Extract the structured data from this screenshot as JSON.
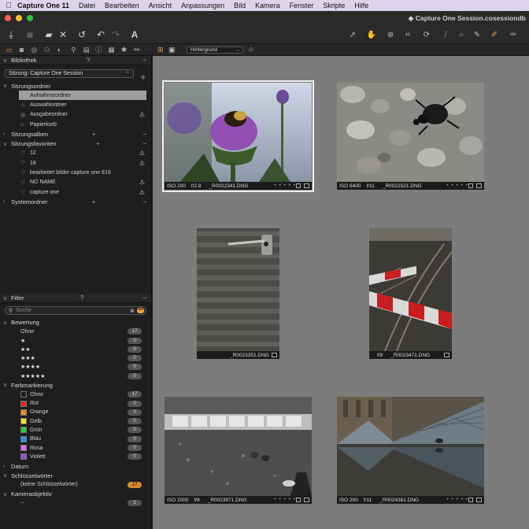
{
  "menubar": {
    "apple": "",
    "app": "Capture One 11",
    "items": [
      "Datei",
      "Bearbeiten",
      "Ansicht",
      "Anpassungen",
      "Bild",
      "Kamera",
      "Fenster",
      "Skripte",
      "Hilfe"
    ]
  },
  "window": {
    "title": "Capture One Session.cosessiondb"
  },
  "colors": {
    "accent": "#e9a23b",
    "close": "#ff5f57",
    "min": "#febc2e",
    "max": "#28c840"
  },
  "library": {
    "title": "Bibliothek",
    "help": "?",
    "menu": "–",
    "session_select": "Sitzung: Capture One Session",
    "folders_header": "Sitzungsordner",
    "folders": [
      {
        "label": "Aufnahmeordner",
        "icon": "◎",
        "selected": true,
        "warn": ""
      },
      {
        "label": "Auswahlordner",
        "icon": "☆",
        "selected": false,
        "warn": ""
      },
      {
        "label": "Ausgabeordner",
        "icon": "◎",
        "selected": false,
        "warn": "⚠"
      },
      {
        "label": "Papierkorb",
        "icon": "⌂",
        "selected": false,
        "warn": ""
      }
    ],
    "albums_header": "Sitzungsalben",
    "favorites_header": "Sitzungsfavoriten",
    "favorites": [
      {
        "label": "12",
        "warn": "⚠"
      },
      {
        "label": "18",
        "warn": "⚠"
      },
      {
        "label": "bearbeitet bilder capture one 819",
        "warn": ""
      },
      {
        "label": "NO NAME",
        "warn": "⚠"
      },
      {
        "label": "capture one",
        "warn": "⚠"
      }
    ],
    "system_header": "Systemordner"
  },
  "filter": {
    "title": "Filter",
    "help": "?",
    "menu": "–",
    "search_placeholder": "Suche",
    "rating_header": "Bewertung",
    "ratings": [
      {
        "label": "Ohne",
        "count": "17"
      },
      {
        "label": "★",
        "count": "0"
      },
      {
        "label": "★★",
        "count": "0"
      },
      {
        "label": "★★★",
        "count": "0"
      },
      {
        "label": "★★★★",
        "count": "0"
      },
      {
        "label": "★★★★★",
        "count": "0"
      }
    ],
    "color_header": "Farbmarkierung",
    "colors": [
      {
        "label": "Ohne",
        "count": "17",
        "swatch": "#1c1c1c"
      },
      {
        "label": "Rot",
        "count": "0",
        "swatch": "#e02424"
      },
      {
        "label": "Orange",
        "count": "0",
        "swatch": "#f08a1c"
      },
      {
        "label": "Gelb",
        "count": "0",
        "swatch": "#f2e02a"
      },
      {
        "label": "Grün",
        "count": "0",
        "swatch": "#2ec83a"
      },
      {
        "label": "Blau",
        "count": "0",
        "swatch": "#2b8df0"
      },
      {
        "label": "Rosa",
        "count": "0",
        "swatch": "#e56be0"
      },
      {
        "label": "Violett",
        "count": "0",
        "swatch": "#9b4de0"
      }
    ],
    "date_header": "Datum",
    "keywords_header": "Schlüsselwörter",
    "keywords": [
      {
        "label": "(keine Schlüsselwörter)",
        "count": "17"
      }
    ],
    "lens_header": "Kameraobjektiv",
    "lens": [
      {
        "label": "--",
        "count": "1"
      }
    ]
  },
  "viewer": {
    "background_select": "Hintergrund"
  },
  "thumbnails": [
    {
      "iso": "ISO 200",
      "aperture": "f/2.8",
      "file": "_R0022341.DNG",
      "dots": "• • • • •",
      "selected": true
    },
    {
      "iso": "ISO 6400",
      "aperture": "f/11",
      "file": "_R0022521.DNG",
      "dots": "• • • • •",
      "selected": false
    },
    {
      "iso": "",
      "aperture": "",
      "file": "_R0023351.DNG",
      "dots": "",
      "selected": false
    },
    {
      "iso": "",
      "aperture": "f/8",
      "file": "_R0023471.DNG",
      "dots": "",
      "selected": false
    },
    {
      "iso": "ISO 2000",
      "aperture": "f/8",
      "file": "_R0023871.DNG",
      "dots": "• • • • •",
      "selected": false
    },
    {
      "iso": "ISO 200",
      "aperture": "f/11",
      "file": "_R0024361.DNG",
      "dots": "• • • • •",
      "selected": false
    }
  ]
}
